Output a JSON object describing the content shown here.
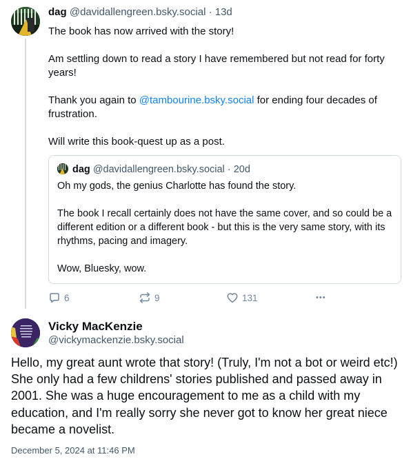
{
  "post1": {
    "author_name": "dag",
    "author_handle": "@davidallengreen.bsky.social",
    "separator": "·",
    "time_ago": "13d",
    "text_line1": "The book has now arrived with the story!",
    "text_line2": "Am settling down to read a story I have remembered but not read for forty years!",
    "text_line3_before": "Thank you again to ",
    "text_line3_mention": "@tambourine.bsky.social",
    "text_line3_after": " for ending four decades of frustration.",
    "text_line4": "Will write this book-quest up as a post.",
    "quote": {
      "author_name": "dag",
      "author_handle": "@davidallengreen.bsky.social",
      "separator": "·",
      "time_ago": "20d",
      "para1": "Oh my gods, the genius Charlotte has found the story.",
      "para2": "The book I recall certainly does not have the same cover, and so could be a different edition or a different book - but this is the very same story, with its rhythms, pacing and imagery.",
      "para3": "Wow, Bluesky, wow."
    },
    "actions": {
      "replies": "6",
      "reposts": "9",
      "likes": "131",
      "more": "•••"
    }
  },
  "post2": {
    "author_name": "Vicky MacKenzie",
    "author_handle": "@vickymackenzie.bsky.social",
    "text": "Hello, my great aunt wrote that story! (Truly, I'm not a bot or weird etc!) She only had a few childrens' stories published and passed away in 2001. She was a huge encouragement to me as a child with my education, and I'm really sorry she never got to know her great niece became a novelist.",
    "date": "December 5, 2024 at 11:46 PM"
  },
  "colors": {
    "text": "#0b0f14",
    "secondary": "#42576c",
    "mention": "#1083fe",
    "border": "#d4dbe2",
    "icon": "#6f869f"
  },
  "icons": [
    "reply-icon",
    "repost-icon",
    "like-icon",
    "more-icon"
  ]
}
